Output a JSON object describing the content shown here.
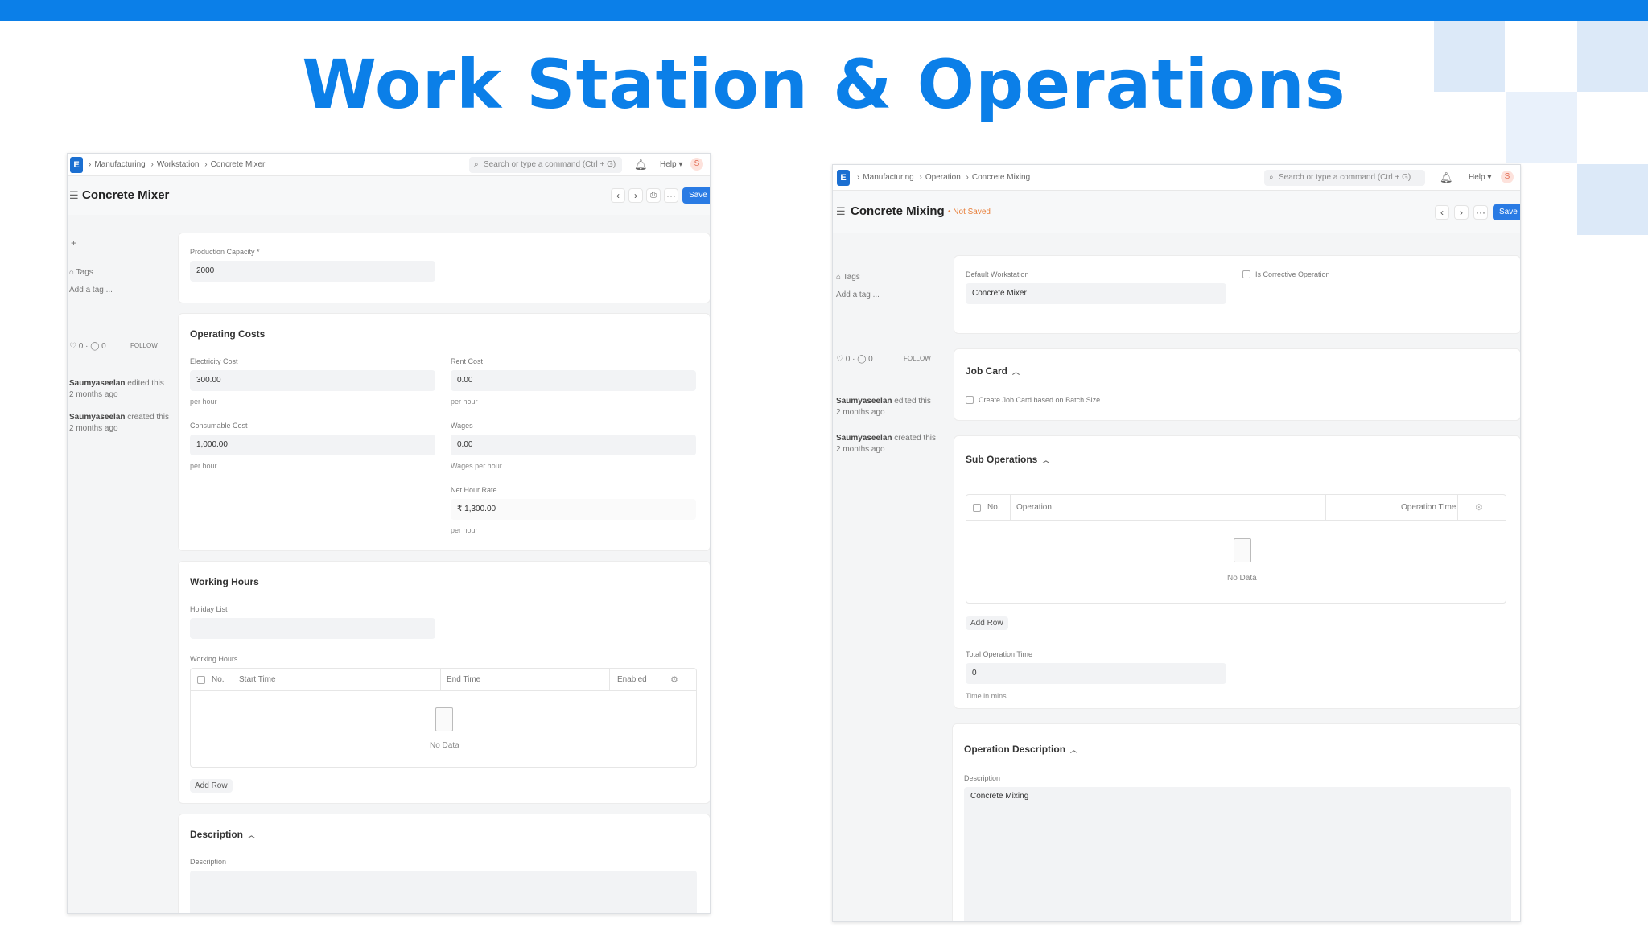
{
  "slide": {
    "title": "Work Station & Operations",
    "accent": "#0b7fe8"
  },
  "common": {
    "logo_letter": "E",
    "search_placeholder": "Search or type a command (Ctrl + G)",
    "help_label": "Help",
    "avatar_letter": "S",
    "save_label": "Save",
    "tags_label": "Tags",
    "add_tag": "Add a tag ...",
    "likes": "0",
    "comments": "0",
    "follow_label": "FOLLOW",
    "activity_user": "Saumyaseelan",
    "edited_text": "edited this",
    "created_text": "created this",
    "time_ago": "2 months ago",
    "no_data": "No Data",
    "add_row": "Add Row",
    "col_no": "No.",
    "description_label": "Description"
  },
  "left": {
    "breadcrumbs": [
      "Manufacturing",
      "Workstation",
      "Concrete Mixer"
    ],
    "title": "Concrete Mixer",
    "production_capacity_label": "Production Capacity *",
    "production_capacity": "2000",
    "operating_costs_title": "Operating Costs",
    "electricity_cost_label": "Electricity Cost",
    "electricity_cost": "300.00",
    "per_hour": "per hour",
    "rent_cost_label": "Rent Cost",
    "rent_cost": "0.00",
    "consumable_cost_label": "Consumable Cost",
    "consumable_cost": "1,000.00",
    "wages_label": "Wages",
    "wages": "0.00",
    "wages_per_hour": "Wages per hour",
    "net_hour_rate_label": "Net Hour Rate",
    "net_hour_rate": "₹ 1,300.00",
    "working_hours_title": "Working Hours",
    "holiday_list_label": "Holiday List",
    "working_hours_label": "Working Hours",
    "columns": [
      "Start Time",
      "End Time",
      "Enabled"
    ],
    "description_title": "Description"
  },
  "right": {
    "breadcrumbs": [
      "Manufacturing",
      "Operation",
      "Concrete Mixing"
    ],
    "title": "Concrete Mixing",
    "status": "Not Saved",
    "default_workstation_label": "Default Workstation",
    "default_workstation": "Concrete Mixer",
    "is_corrective_label": "Is Corrective Operation",
    "job_card_title": "Job Card",
    "create_job_card_label": "Create Job Card based on Batch Size",
    "sub_operations_title": "Sub Operations",
    "columns": [
      "Operation",
      "Operation Time"
    ],
    "total_operation_time_label": "Total Operation Time",
    "total_operation_time": "0",
    "time_in_mins": "Time in mins",
    "operation_description_title": "Operation Description",
    "description_value": "Concrete Mixing"
  }
}
